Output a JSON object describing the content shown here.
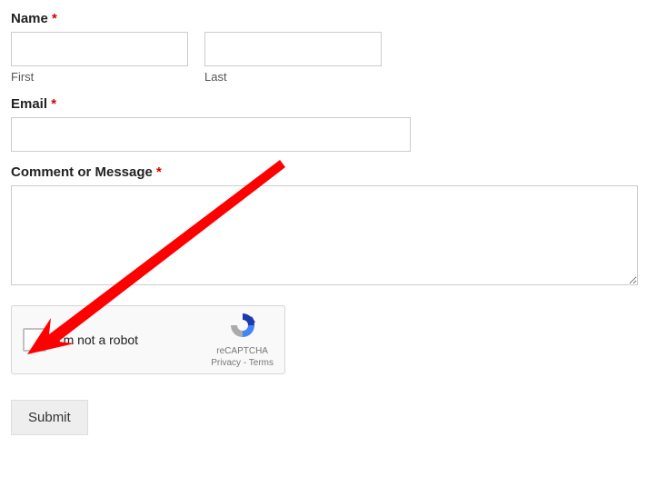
{
  "form": {
    "name": {
      "label": "Name",
      "required": "*",
      "first_sub": "First",
      "last_sub": "Last",
      "first_value": "",
      "last_value": ""
    },
    "email": {
      "label": "Email",
      "required": "*",
      "value": ""
    },
    "comment": {
      "label": "Comment or Message",
      "required": "*",
      "value": ""
    },
    "recaptcha": {
      "label": "I'm not a robot",
      "brand": "reCAPTCHA",
      "privacy": "Privacy",
      "terms": "Terms",
      "sep": " - "
    },
    "submit_label": "Submit"
  },
  "colors": {
    "required": "#d40000",
    "arrow": "#ff0000"
  }
}
